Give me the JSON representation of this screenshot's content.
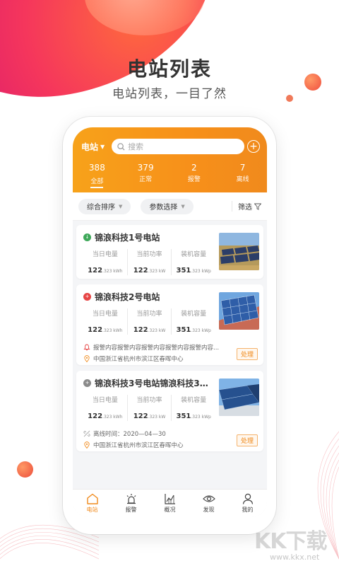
{
  "hero": {
    "title": "电站列表",
    "subtitle": "电站列表，一目了然"
  },
  "app": {
    "station_select": "电站",
    "search": {
      "placeholder": "搜索"
    },
    "stats": [
      {
        "num": "388",
        "label": "全部",
        "active": true
      },
      {
        "num": "379",
        "label": "正常",
        "active": false
      },
      {
        "num": "2",
        "label": "报警",
        "active": false
      },
      {
        "num": "7",
        "label": "离线",
        "active": false
      }
    ],
    "filters": {
      "sort": "综合排序",
      "params": "参数选择",
      "filter": "筛选"
    },
    "metric_labels": {
      "daily": "当日电量",
      "power": "当前功率",
      "capacity": "装机容量"
    },
    "stations": [
      {
        "name": "锦浪科技1号电站",
        "status": "normal",
        "daily": {
          "value": "122",
          "unit": ".323 kWh"
        },
        "power": {
          "value": "122",
          "unit": ".323 kW"
        },
        "capacity": {
          "value": "351",
          "unit": ".323 kWp"
        }
      },
      {
        "name": "锦浪科技2号电站",
        "status": "alarm",
        "daily": {
          "value": "122",
          "unit": ".323 kWh"
        },
        "power": {
          "value": "122",
          "unit": ".323 kW"
        },
        "capacity": {
          "value": "351",
          "unit": ".323 kWp"
        },
        "alert": "报警内容报警内容报警内容报警内容报警内容...",
        "address": "中国浙江省杭州市滨江区春晖中心",
        "action": "处理"
      },
      {
        "name": "锦浪科技3号电站锦浪科技3号...",
        "status": "offline",
        "daily": {
          "value": "122",
          "unit": ".323 kWh"
        },
        "power": {
          "value": "122",
          "unit": ".323 kW"
        },
        "capacity": {
          "value": "351",
          "unit": ".323 kWp"
        },
        "offline": "离线时间：2020—04—30",
        "address": "中国浙江省杭州市滨江区春晖中心",
        "action": "处理"
      }
    ],
    "tabs": [
      {
        "label": "电站",
        "icon": "home-icon",
        "active": true
      },
      {
        "label": "报警",
        "icon": "alarm-icon",
        "active": false
      },
      {
        "label": "概况",
        "icon": "chart-icon",
        "active": false
      },
      {
        "label": "发现",
        "icon": "eye-icon",
        "active": false
      },
      {
        "label": "我的",
        "icon": "user-icon",
        "active": false
      }
    ]
  },
  "colors": {
    "accent": "#f08a1c",
    "header": "#f7a21a",
    "normal": "#3fa85a",
    "alarm": "#e64545",
    "offline": "#8a8a8a"
  },
  "watermark": {
    "text": "KK下载",
    "url": "www.kkx.net"
  }
}
